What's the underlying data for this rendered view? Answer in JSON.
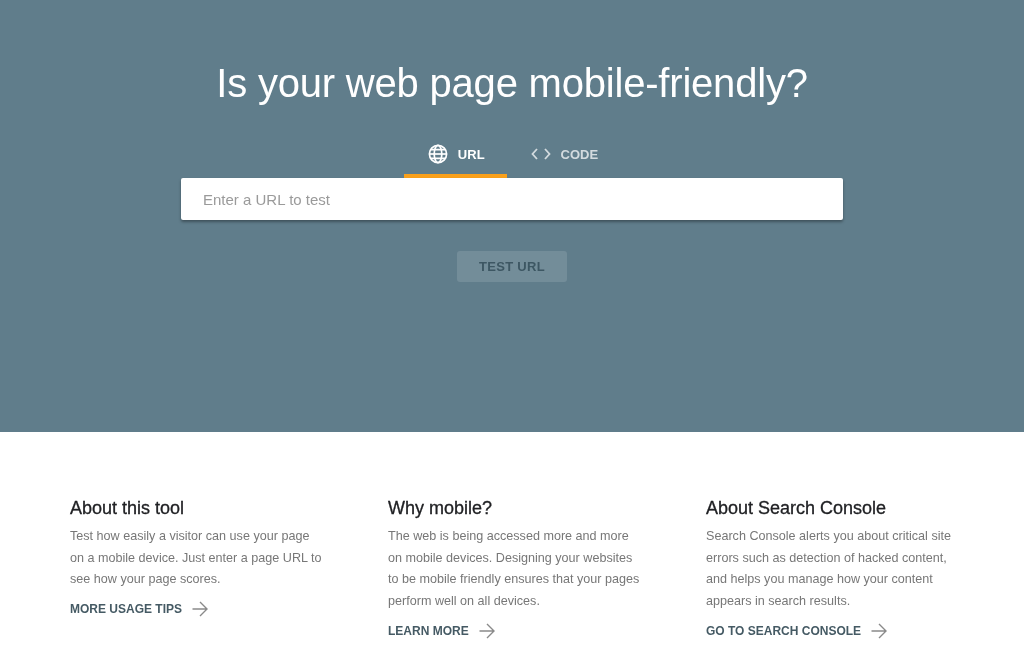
{
  "title": "Is your web page mobile-friendly?",
  "tabs": [
    {
      "label": "URL",
      "kind": "url",
      "selected": true
    },
    {
      "label": "CODE",
      "kind": "code",
      "selected": false
    }
  ],
  "url_field": {
    "placeholder": "Enter a URL to test"
  },
  "test_button": {
    "label": "TEST URL",
    "disabled": true
  },
  "sections": [
    {
      "heading": "About this tool",
      "text": "Test how easily a visitor can use your page on a mobile device. Just enter a page URL to see how your page scores.",
      "link": "MORE USAGE TIPS"
    },
    {
      "heading": "Why mobile?",
      "text": "The web is being accessed more and more on mobile devices. Designing your websites to be mobile friendly ensures that your pages perform well on all devices.",
      "link": "LEARN MORE"
    },
    {
      "heading": "About Search Console",
      "text": "Search Console alerts you about critical site errors such as detection of hacked content, and helps you manage how your content appears in search results.",
      "link": "GO TO SEARCH CONSOLE"
    }
  ]
}
